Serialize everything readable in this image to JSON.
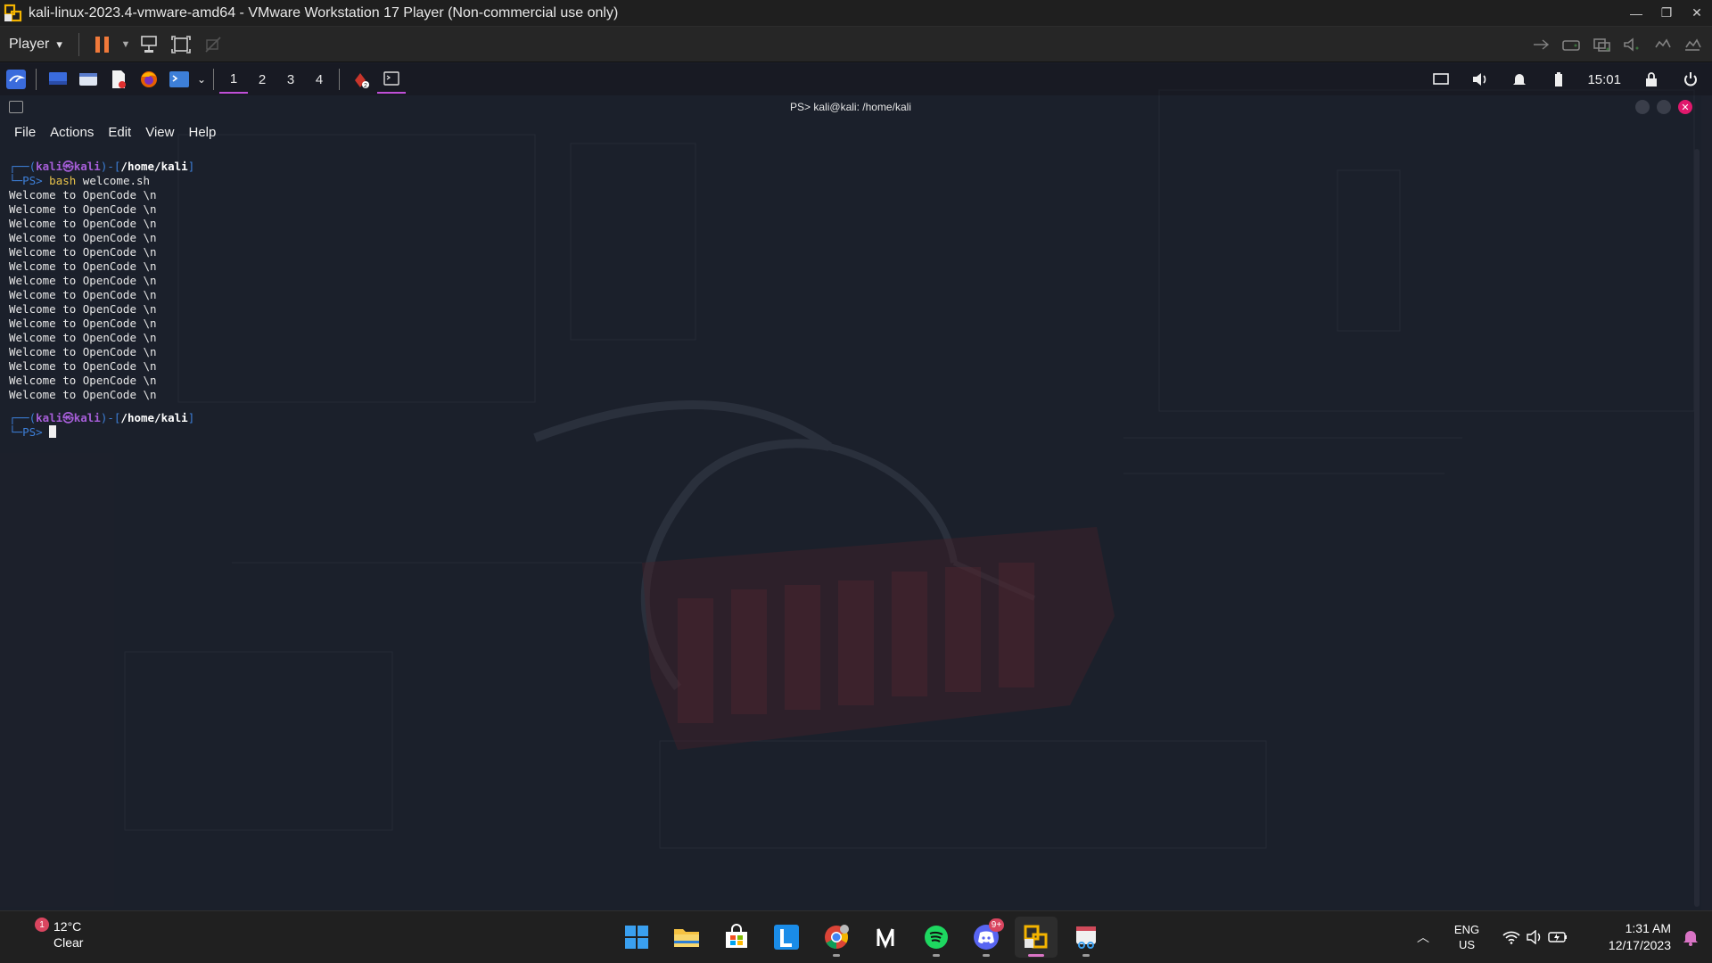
{
  "vm_window": {
    "title": "kali-linux-2023.4-vmware-amd64 - VMware Workstation 17 Player (Non-commercial use only)",
    "controls": {
      "minimize": "—",
      "restore": "❐",
      "close": "✕"
    }
  },
  "vm_toolbar": {
    "player_label": "Player",
    "player_caret": "▾"
  },
  "kali_panel": {
    "workspaces": [
      "1",
      "2",
      "3",
      "4"
    ],
    "active_workspace": "1",
    "clock": "15:01",
    "colors": {
      "active_workspace_underline": "#c04fd8",
      "kali_menu": "#3a6bdc"
    }
  },
  "terminal": {
    "title": "PS> kali@kali: /home/kali",
    "close_glyph": "✕",
    "menu": [
      "File",
      "Actions",
      "Edit",
      "View",
      "Help"
    ],
    "prompt": {
      "open": "┌──(",
      "user": "kali",
      "at": "㉿",
      "host": "kali",
      "mid": ")-[",
      "path": "/home/kali",
      "close": "]",
      "corner": "└─",
      "ps": "PS> "
    },
    "command_bin": "bash",
    "command_arg": " welcome.sh",
    "output_lines": [
      "Welcome to OpenCode \\n",
      "Welcome to OpenCode \\n",
      "Welcome to OpenCode \\n",
      "Welcome to OpenCode \\n",
      "Welcome to OpenCode \\n",
      "Welcome to OpenCode \\n",
      "Welcome to OpenCode \\n",
      "Welcome to OpenCode \\n",
      "Welcome to OpenCode \\n",
      "Welcome to OpenCode \\n",
      "Welcome to OpenCode \\n",
      "Welcome to OpenCode \\n",
      "Welcome to OpenCode \\n",
      "Welcome to OpenCode \\n",
      "Welcome to OpenCode \\n"
    ],
    "colors": {
      "prompt_frame": "#3d7fd8",
      "user_host": "#a65ed8",
      "command": "#e8c24a",
      "text": "#e8e8e8"
    }
  },
  "taskbar": {
    "weather": {
      "temp": "12°C",
      "condition": "Clear",
      "badge": "1"
    },
    "apps": [
      {
        "name": "windows-start",
        "icon": "windows-logo-icon",
        "active": false,
        "running": false
      },
      {
        "name": "file-explorer",
        "icon": "folder-icon",
        "active": false,
        "running": false
      },
      {
        "name": "microsoft-store",
        "icon": "store-icon",
        "active": false,
        "running": false
      },
      {
        "name": "l-app",
        "icon": "l-app-icon",
        "active": false,
        "running": false
      },
      {
        "name": "chrome",
        "icon": "chrome-icon",
        "active": false,
        "running": true
      },
      {
        "name": "notion",
        "icon": "notion-icon",
        "active": false,
        "running": false
      },
      {
        "name": "spotify",
        "icon": "spotify-icon",
        "active": false,
        "running": true
      },
      {
        "name": "discord",
        "icon": "discord-icon",
        "active": false,
        "running": true,
        "badge": "9+"
      },
      {
        "name": "vmware",
        "icon": "vmware-icon",
        "active": true,
        "running": true
      },
      {
        "name": "snipping-tool",
        "icon": "snipping-tool-icon",
        "active": false,
        "running": true
      }
    ],
    "language": {
      "line1": "ENG",
      "line2": "US"
    },
    "clock": {
      "time": "1:31 AM",
      "date": "12/17/2023"
    },
    "tray_chevron": "︿"
  }
}
